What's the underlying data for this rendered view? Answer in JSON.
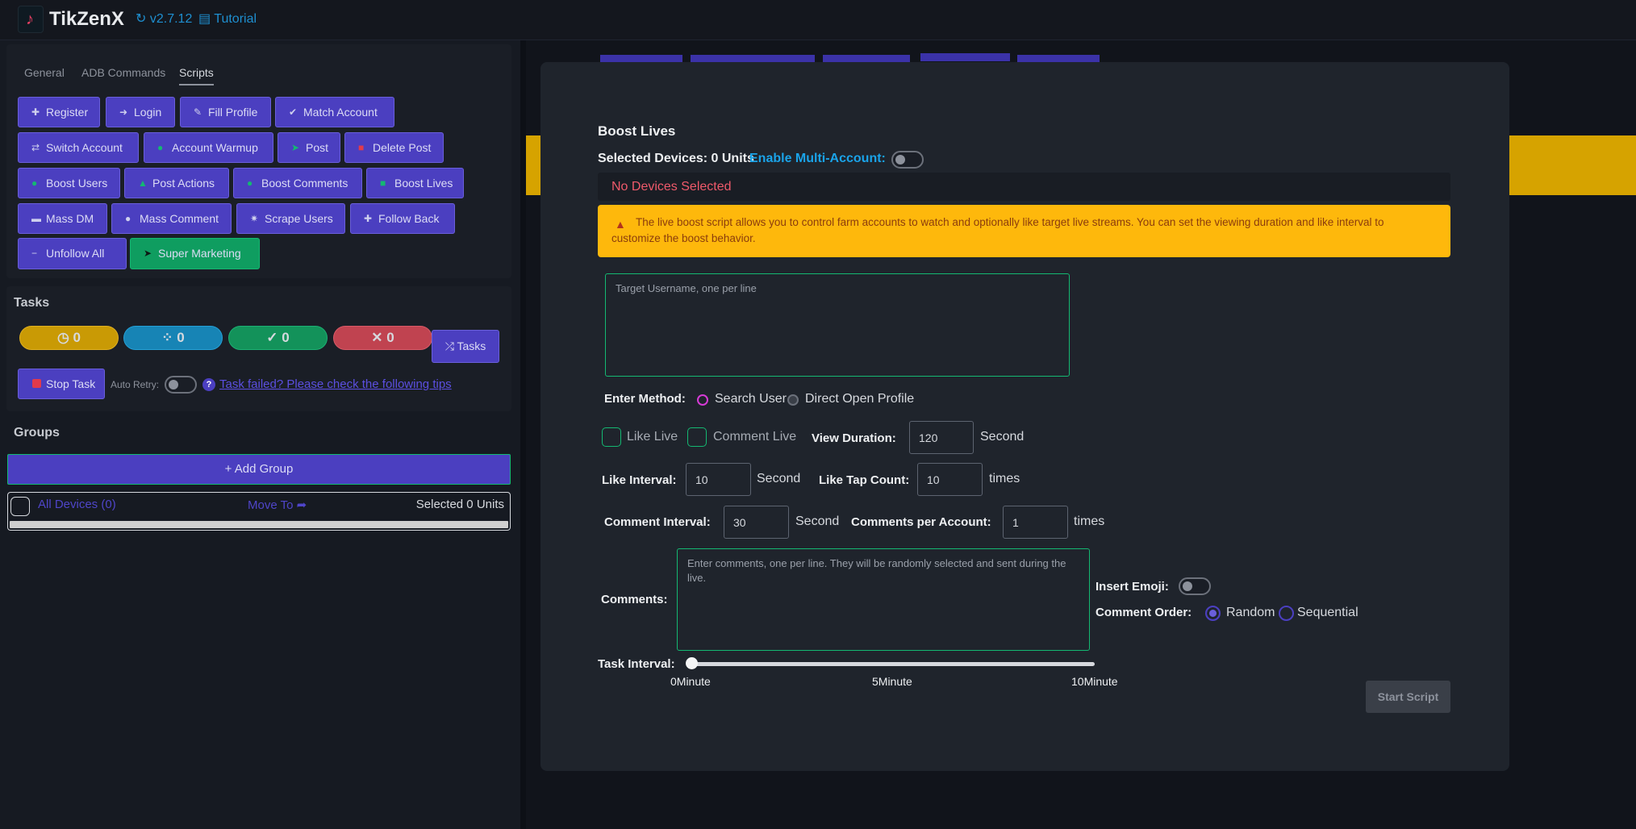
{
  "header": {
    "app_title": "TikZenX",
    "version": "↻ v2.7.12",
    "tutorial": "▤ Tutorial"
  },
  "sidebar": {
    "tabs": [
      {
        "label": "General"
      },
      {
        "label": "ADB Commands"
      },
      {
        "label": "Scripts"
      }
    ],
    "script_buttons": [
      {
        "label": "Register",
        "icon": "user-plus-icon"
      },
      {
        "label": "Login",
        "icon": "sign-in-icon"
      },
      {
        "label": "Fill Profile",
        "icon": "user-edit-icon"
      },
      {
        "label": "Match Account",
        "icon": "user-check-icon"
      },
      {
        "label": "Switch Account",
        "icon": "exchange-icon"
      },
      {
        "label": "Account Warmup",
        "icon": "fire-icon"
      },
      {
        "label": "Post",
        "icon": "send-icon"
      },
      {
        "label": "Delete Post",
        "icon": "trash-icon"
      },
      {
        "label": "Boost Users",
        "icon": "user-icon"
      },
      {
        "label": "Post Actions",
        "icon": "thumbs-up-icon"
      },
      {
        "label": "Boost Comments",
        "icon": "comment-icon"
      },
      {
        "label": "Boost Lives",
        "icon": "video-icon"
      },
      {
        "label": "Mass DM",
        "icon": "message-icon"
      },
      {
        "label": "Mass Comment",
        "icon": "comment-dots-icon"
      },
      {
        "label": "Scrape Users",
        "icon": "spider-icon"
      },
      {
        "label": "Follow Back",
        "icon": "user-plus-icon"
      },
      {
        "label": "Unfollow All",
        "icon": "user-minus-icon"
      },
      {
        "label": "Super Marketing",
        "icon": "rocket-icon"
      }
    ]
  },
  "tasks": {
    "title": "Tasks",
    "counters": [
      {
        "label": "◷ 0",
        "color": "#c99a05"
      },
      {
        "label": "⁘ 0",
        "color": "#1784b5"
      },
      {
        "label": "✓ 0",
        "color": "#13925a"
      },
      {
        "label": "✕ 0",
        "color": "#c04350"
      }
    ],
    "tasks_button": "⤮  Tasks",
    "stop_button": "Stop Task",
    "auto_retry_label": "Auto Retry:",
    "tips_link": "Task failed? Please check the following tips"
  },
  "groups": {
    "title": "Groups",
    "add_group": "+  Add Group",
    "all_devices": "All Devices (0)",
    "move_to": "Move To ➦",
    "selected_units": "Selected 0 Units"
  },
  "modal": {
    "title": "Boost Lives",
    "selected_devices": "Selected Devices: 0 Units",
    "multi_account_label": "Enable Multi-Account:",
    "no_devices": "No Devices Selected",
    "info_text": "The live boost script allows you to control farm accounts to watch and optionally like target live streams. You can set the viewing duration and like interval to customize the boost behavior.",
    "target_placeholder": "Target Username, one per line",
    "enter_method_label": "Enter Method:",
    "method_search": "Search User",
    "method_direct": "Direct Open Profile",
    "like_live": "Like Live",
    "comment_live": "Comment Live",
    "view_duration_label": "View Duration:",
    "view_duration_value": "120",
    "second": "Second",
    "times": "times",
    "like_interval_label": "Like Interval:",
    "like_interval_value": "10",
    "like_tap_label": "Like Tap Count:",
    "like_tap_value": "10",
    "comment_interval_label": "Comment Interval:",
    "comment_interval_value": "30",
    "comments_per_account_label": "Comments per Account:",
    "comments_per_account_value": "1",
    "comments_label": "Comments:",
    "comments_placeholder": "Enter comments, one per line. They will be randomly selected and sent during the live.",
    "insert_emoji_label": "Insert Emoji:",
    "comment_order_label": "Comment Order:",
    "order_random": "Random",
    "order_sequential": "Sequential",
    "task_interval_label": "Task Interval:",
    "task_interval_value": 0,
    "task_interval_max": 10,
    "ticks": [
      "0Minute",
      "5Minute",
      "10Minute"
    ],
    "start_button": "Start Script"
  }
}
